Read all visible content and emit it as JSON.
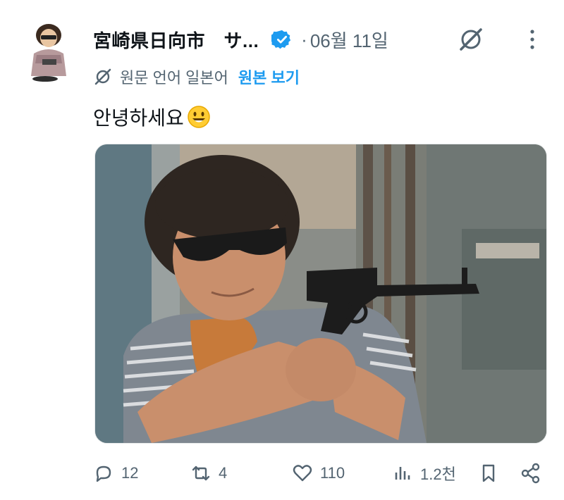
{
  "post": {
    "author_name": "宮崎県日向市　サ...",
    "separator": "·",
    "date": "06월 11일",
    "translation_label": "원문 언어 일본어",
    "show_original_label": "원본 보기",
    "text": "안녕하세요",
    "emoji": "smiling-face-emoji",
    "verified_color": "#1d9bf0"
  },
  "actions": {
    "replies": "12",
    "reposts": "4",
    "likes": "110",
    "views": "1.2천"
  },
  "colors": {
    "text_primary": "#0f1419",
    "text_secondary": "#536471",
    "accent": "#1d9bf0"
  },
  "icons": {
    "verified": "verified-badge-icon",
    "grok": "grok-icon",
    "more": "more-dots-icon",
    "reply": "reply-icon",
    "repost": "repost-icon",
    "like": "heart-icon",
    "views": "views-chart-icon",
    "bookmark": "bookmark-icon",
    "share": "share-icon"
  }
}
